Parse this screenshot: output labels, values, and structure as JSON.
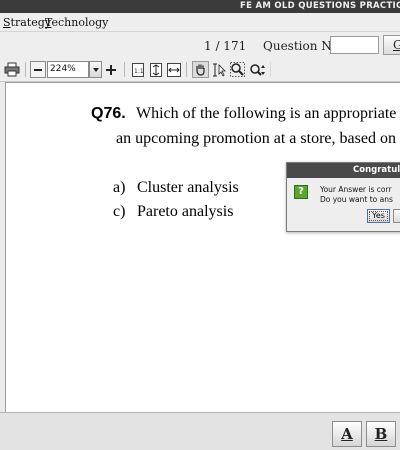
{
  "window": {
    "title": "FE AM OLD QUESTIONS PRACTICE SC"
  },
  "menubar": {
    "items": [
      {
        "label": "trategy",
        "mnemonic": "S"
      },
      {
        "label": "echnology",
        "mnemonic": "T"
      }
    ]
  },
  "nav": {
    "page_indicator": "1 / 171",
    "question_no_label": "Question No.",
    "question_no_value": "",
    "go_label": "G"
  },
  "toolbar": {
    "zoom_value": "224%",
    "icons": [
      "print-icon",
      "zoom-out-icon",
      "zoom-select",
      "zoom-in-icon",
      "actual-size-icon",
      "fit-page-icon",
      "fit-width-icon",
      "hand-tool-icon",
      "text-select-icon",
      "marquee-zoom-icon",
      "dynamic-zoom-icon"
    ]
  },
  "question": {
    "number": "Q76.",
    "line1": "Which of the following is an appropriate m",
    "line2": "an upcoming promotion at a store, based on h",
    "options": [
      {
        "letter": "a)",
        "text": "Cluster analysis"
      },
      {
        "letter": "c)",
        "text": "Pareto analysis"
      }
    ]
  },
  "dialog": {
    "title": "Congratula",
    "icon": "question-icon",
    "message_line1": "Your Answer is corr",
    "message_line2": "Do you want to ans",
    "yes_label": "Yes"
  },
  "answers": {
    "buttons": [
      "A",
      "B"
    ]
  }
}
